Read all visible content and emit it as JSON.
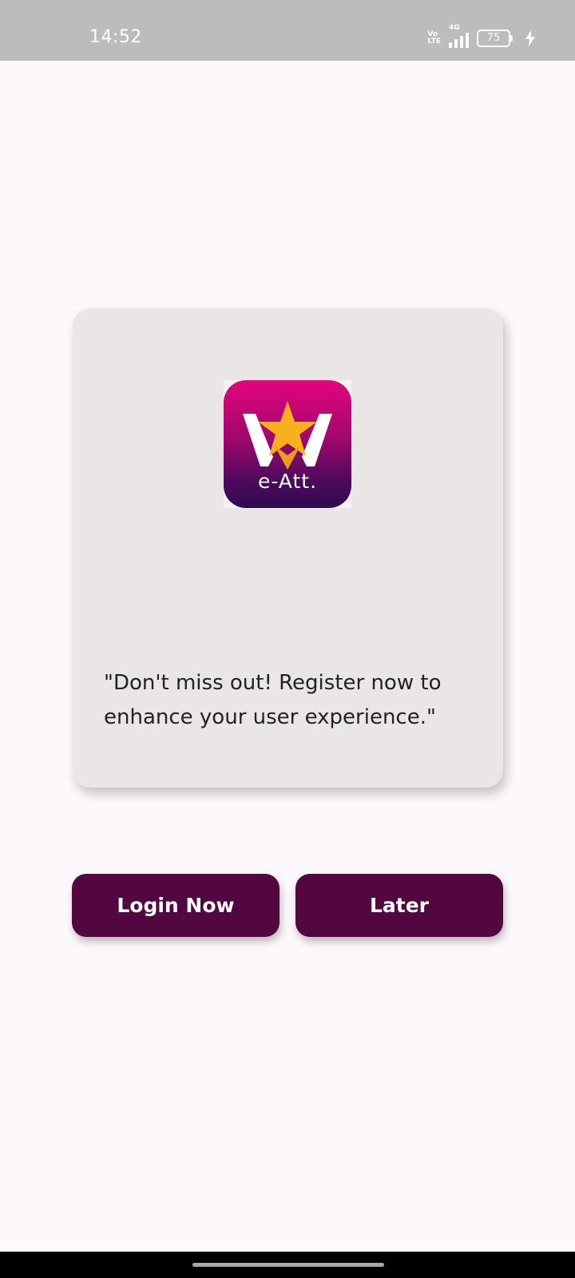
{
  "status_bar": {
    "time": "14:52",
    "volte_top": "Vo",
    "volte_bottom": "LTE",
    "network": "4G",
    "battery": "75",
    "icons": [
      "volte-icon",
      "signal-icon",
      "battery-icon",
      "charging-icon"
    ]
  },
  "card": {
    "logo_text": "e-Att.",
    "logo_icon": "e-att-logo",
    "message": "\"Don't miss out! Register now to enhance your user experience.\""
  },
  "actions": {
    "login_label": "Login Now",
    "later_label": "Later"
  },
  "colors": {
    "button": "#520741",
    "card": "#ebe6e6",
    "background": "#fcf8fb",
    "status_bar": "#bdbcbd",
    "logo_gradient_top": "#e4047d",
    "logo_gradient_bottom": "#2f0a50",
    "star": "#f8b020"
  }
}
